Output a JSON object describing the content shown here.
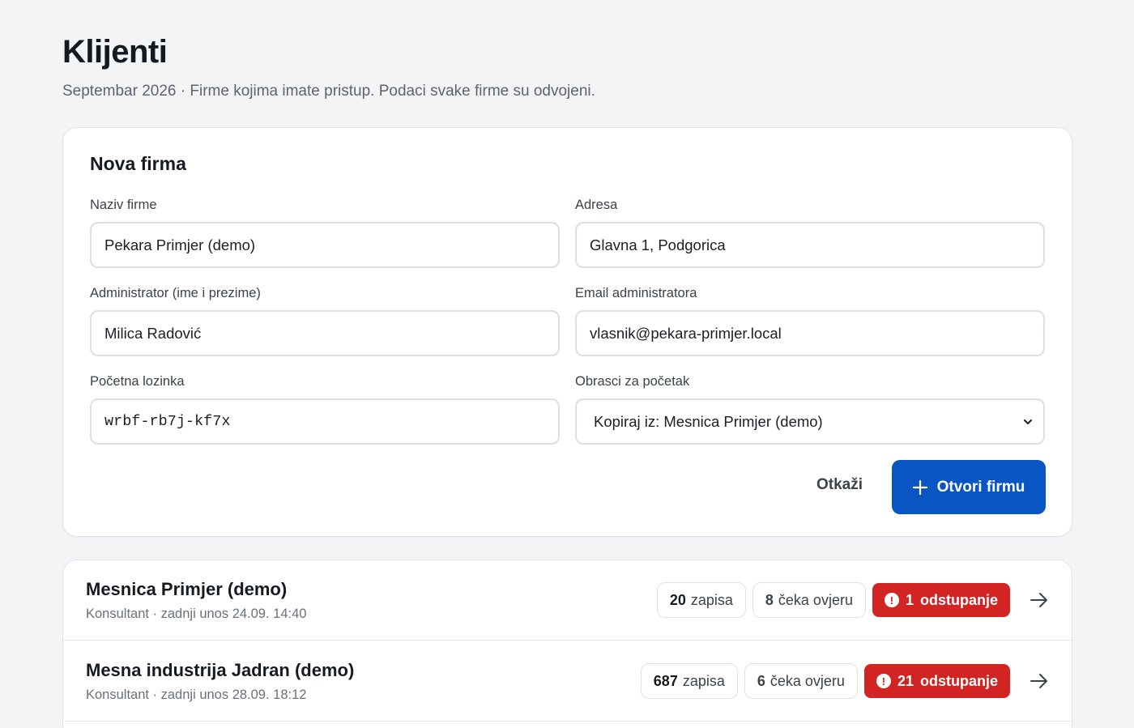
{
  "header": {
    "title": "Klijenti",
    "subtitle": "Septembar 2026 · Firme kojima imate pristup. Podaci svake firme su odvojeni."
  },
  "form": {
    "title": "Nova firma",
    "fields": {
      "company_name": {
        "label": "Naziv firme",
        "value": "Pekara Primjer (demo)"
      },
      "address": {
        "label": "Adresa",
        "value": "Glavna 1, Podgorica"
      },
      "admin_name": {
        "label": "Administrator (ime i prezime)",
        "value": "Milica Radović"
      },
      "admin_email": {
        "label": "Email administratora",
        "value": "vlasnik@pekara-primjer.local"
      },
      "password": {
        "label": "Početna lozinka",
        "value": "wrbf-rb7j-kf7x"
      },
      "templates": {
        "label": "Obrasci za početak",
        "value": "Kopiraj iz: Mesnica Primjer (demo)"
      }
    },
    "cancel_label": "Otkaži",
    "submit_label": "Otvori firmu"
  },
  "clients": [
    {
      "name": "Mesnica Primjer (demo)",
      "meta": "Konsultant · zadnji unos 24.09. 14:40",
      "records_count": "20",
      "records_label": "zapisa",
      "pending_count": "8",
      "pending_label": "čeka ovjeru",
      "deviations_count": "1",
      "deviations_label": "odstupanje"
    },
    {
      "name": "Mesna industrija Jadran (demo)",
      "meta": "Konsultant · zadnji unos 28.09. 18:12",
      "records_count": "687",
      "records_label": "zapisa",
      "pending_count": "6",
      "pending_label": "čeka ovjeru",
      "deviations_count": "21",
      "deviations_label": "odstupanje"
    }
  ],
  "colors": {
    "primary": "#0a55c4",
    "alert": "#d32424",
    "background": "#f3f4f5"
  }
}
